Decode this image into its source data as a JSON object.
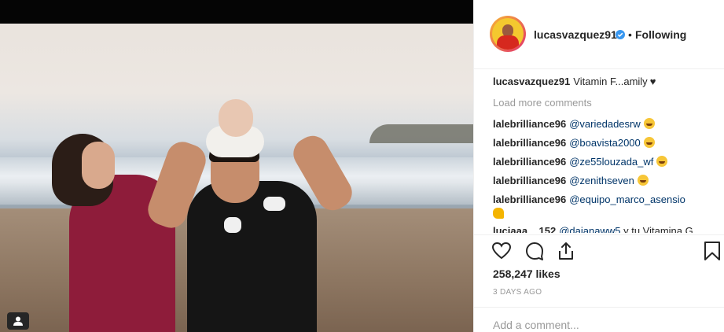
{
  "post": {
    "author": "lucasvazquez91",
    "follow_separator": "•",
    "follow_status": "Following",
    "caption_text": "Vitamin F...amily"
  },
  "comments": {
    "load_more": "Load more comments",
    "items": [
      {
        "user": "lalebrilliance96",
        "mention": "@variedadesrw"
      },
      {
        "user": "lalebrilliance96",
        "mention": "@boavista2000"
      },
      {
        "user": "lalebrilliance96",
        "mention": "@ze55louzada_wf"
      },
      {
        "user": "lalebrilliance96",
        "mention": "@zenithseven"
      },
      {
        "user": "lalebrilliance96",
        "mention": "@equipo_marco_asensio"
      }
    ],
    "partial": {
      "user": "luciaaa__152",
      "mention": "@daianaww5",
      "text": "y tu Vitamina G"
    }
  },
  "actions": {
    "icons": [
      "heart-icon",
      "comment-icon",
      "share-icon",
      "bookmark-icon"
    ]
  },
  "likes": "258,247 likes",
  "time_ago": "3 DAYS AGO",
  "add_comment": {
    "placeholder": "Add a comment..."
  },
  "colors": {
    "link": "#003569",
    "verified": "#3897f0",
    "muted": "#999999",
    "text": "#262626"
  }
}
